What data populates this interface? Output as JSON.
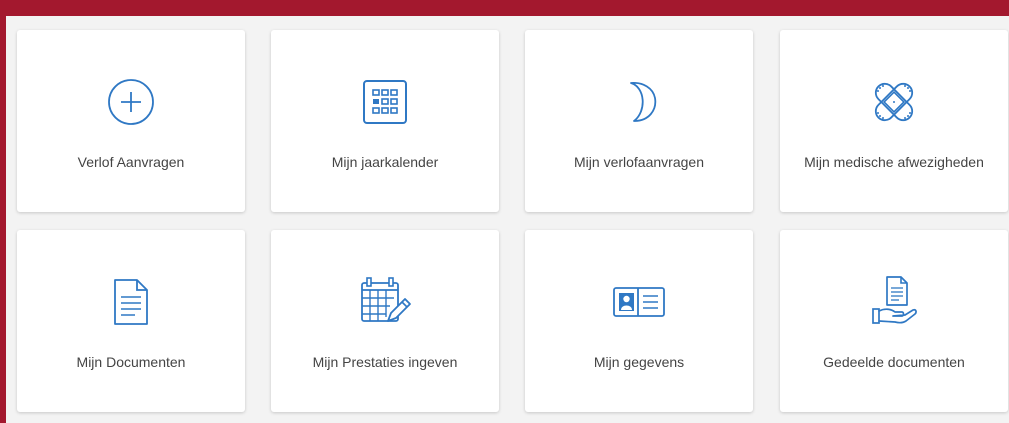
{
  "colors": {
    "accent": "#a3182e",
    "icon": "#2f78c4",
    "text": "#444444"
  },
  "tiles": [
    {
      "label": "Verlof Aanvragen",
      "icon": "plus-circle-icon"
    },
    {
      "label": "Mijn jaarkalender",
      "icon": "calendar-grid-icon"
    },
    {
      "label": "Mijn verlofaanvragen",
      "icon": "moon-icon"
    },
    {
      "label": "Mijn medische afwezigheden",
      "icon": "bandage-icon"
    },
    {
      "label": "Mijn Documenten",
      "icon": "document-icon"
    },
    {
      "label": "Mijn Prestaties ingeven",
      "icon": "calendar-edit-icon"
    },
    {
      "label": "Mijn gegevens",
      "icon": "id-card-icon"
    },
    {
      "label": "Gedeelde documenten",
      "icon": "shared-document-icon"
    }
  ]
}
